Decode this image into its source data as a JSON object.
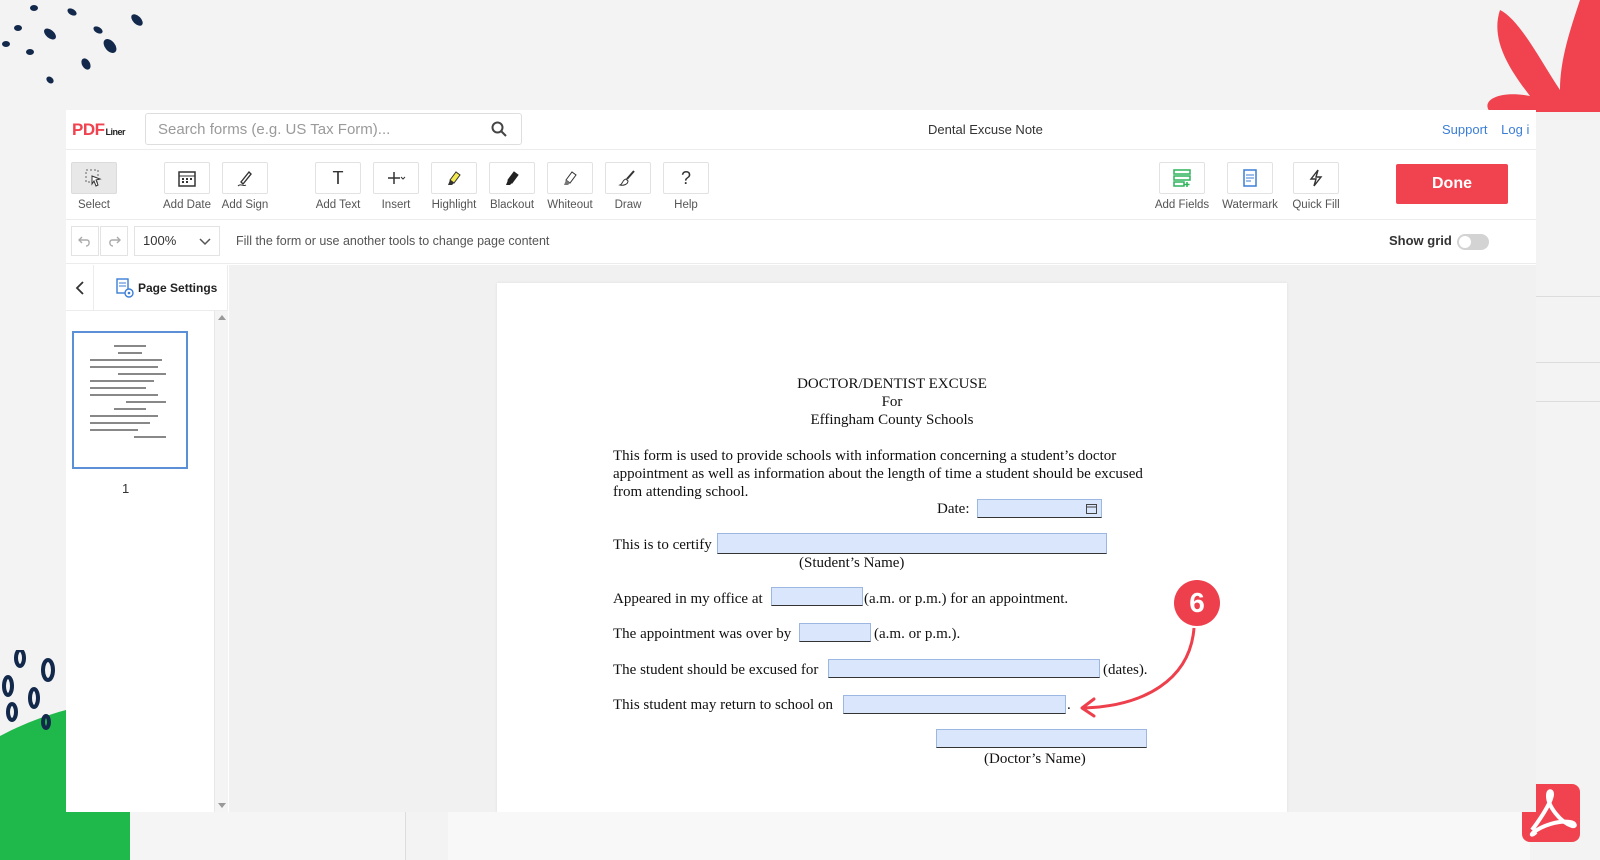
{
  "app": {
    "logo_main": "PDF",
    "logo_sub": "Liner",
    "search_placeholder": "Search forms (e.g. US Tax Form)...",
    "document_title": "Dental Excuse Note",
    "support_link": "Support",
    "login_link": "Log i"
  },
  "toolbar": {
    "tools": [
      {
        "label": "Select",
        "icon": "cursor-icon"
      },
      {
        "label": "Add Date",
        "icon": "calendar-icon"
      },
      {
        "label": "Add Sign",
        "icon": "signature-pen-icon"
      },
      {
        "label": "Add Text",
        "icon": "text-icon"
      },
      {
        "label": "Insert",
        "icon": "plus-icon"
      },
      {
        "label": "Highlight",
        "icon": "highlighter-icon"
      },
      {
        "label": "Blackout",
        "icon": "blackout-icon"
      },
      {
        "label": "Whiteout",
        "icon": "whiteout-icon"
      },
      {
        "label": "Draw",
        "icon": "brush-icon"
      },
      {
        "label": "Help",
        "icon": "question-icon"
      },
      {
        "label": "Add Fields",
        "icon": "fields-icon"
      },
      {
        "label": "Watermark",
        "icon": "watermark-icon"
      },
      {
        "label": "Quick Fill",
        "icon": "lightning-icon"
      }
    ],
    "text_tool_glyph": "T",
    "help_glyph": "?",
    "done_label": "Done"
  },
  "subbar": {
    "zoom": "100%",
    "hint": "Fill the form or use another tools to change page content",
    "show_grid_label": "Show grid",
    "show_grid_on": false
  },
  "sidebar": {
    "page_settings_label": "Page Settings",
    "page_number": "1"
  },
  "document": {
    "heading_line1": "DOCTOR/DENTIST EXCUSE",
    "heading_line2": "For",
    "heading_line3": "Effingham County Schools",
    "intro": "This form is used to provide schools with information concerning a student’s doctor appointment as well as information about the length of time a student should be excused from attending school.",
    "date_label": "Date:",
    "certify_label": "This is to certify",
    "student_name_caption": "(Student’s Name)",
    "appeared_label": "Appeared in my office at",
    "appeared_suffix": "(a.m. or p.m.) for an appointment.",
    "over_label": "The appointment was over by",
    "over_suffix": "(a.m. or p.m.).",
    "excused_label": "The student should be excused for",
    "excused_suffix": "(dates).",
    "return_label": "This student may return to school on",
    "return_suffix": ".",
    "doctor_name_caption": "(Doctor’s Name)"
  },
  "annotation": {
    "step_number": "6"
  },
  "colors": {
    "brand_red": "#f0434f",
    "link_blue": "#3b7ed6",
    "field_fill": "#d9e6fb",
    "deco_green": "#1fb84a",
    "deco_navy": "#13294b"
  }
}
